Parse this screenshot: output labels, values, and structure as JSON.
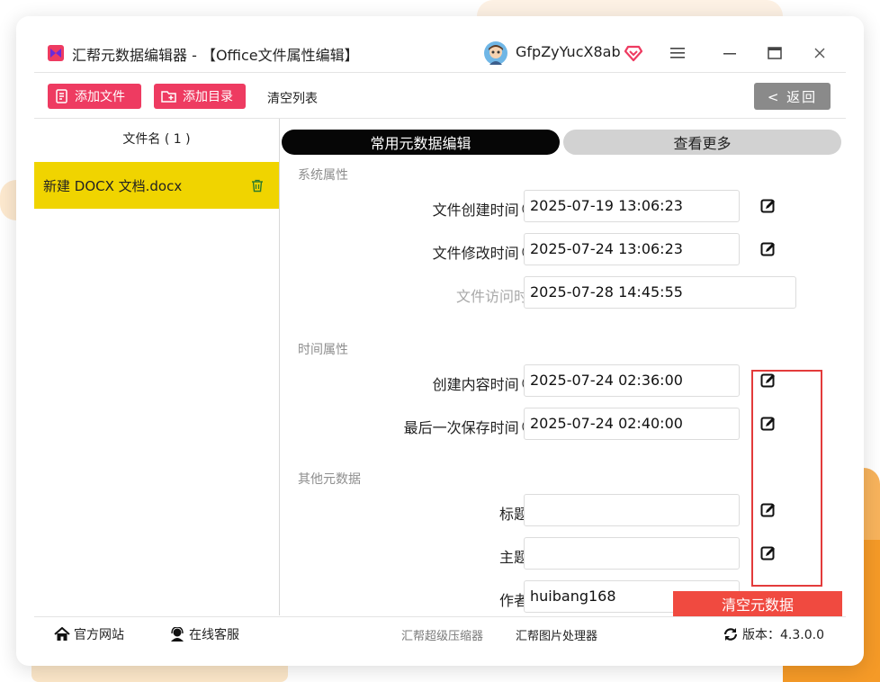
{
  "window": {
    "title": "汇帮元数据编辑器 - 【Office文件属性编辑】",
    "username": "GfpZyYucX8ab"
  },
  "toolbar": {
    "add_file": "添加文件",
    "add_dir": "添加目录",
    "clear_list": "清空列表",
    "back": "< 返回"
  },
  "file_panel": {
    "header": "文件名 ( 1 )",
    "files": [
      {
        "name": "新建 DOCX 文档.docx"
      }
    ]
  },
  "tabs": {
    "common": "常用元数据编辑",
    "more": "查看更多"
  },
  "sections": {
    "system": "系统属性",
    "time": "时间属性",
    "other": "其他元数据"
  },
  "fields": {
    "created": {
      "label": "文件创建时间",
      "value": "2025-07-19 13:06:23"
    },
    "modified": {
      "label": "文件修改时间",
      "value": "2025-07-24 13:06:23"
    },
    "accessed": {
      "label": "文件访问时间",
      "value": "2025-07-28 14:45:55"
    },
    "content_created": {
      "label": "创建内容时间",
      "value": "2025-07-24 02:36:00"
    },
    "last_saved": {
      "label": "最后一次保存时间",
      "value": "2025-07-24 02:40:00"
    },
    "title": {
      "label": "标题：",
      "value": ""
    },
    "subject": {
      "label": "主题：",
      "value": ""
    },
    "author": {
      "label": "作者：",
      "value": "huibang168"
    }
  },
  "clear_metadata": "清空元数据",
  "footer": {
    "site": "官方网站",
    "service": "在线客服",
    "compress": "汇帮超级压缩器",
    "image": "汇帮图片处理器",
    "version": "版本：4.3.0.0"
  },
  "colors": {
    "accent": "#ee3b61",
    "selected_row": "#f0d400",
    "danger": "#f04a40",
    "back_button": "#8a8a8a"
  }
}
